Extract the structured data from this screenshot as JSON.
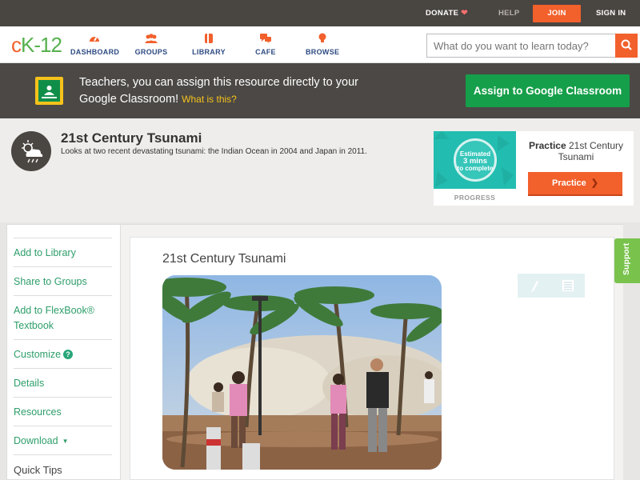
{
  "topbar": {
    "donate": "DONATE",
    "help": "HELP",
    "join": "JOIN",
    "signin": "SIGN IN"
  },
  "nav": {
    "logo_c": "c",
    "logo_k": "K",
    "logo_dash": "-",
    "logo_num": "12",
    "items": [
      {
        "label": "DASHBOARD",
        "icon": "dashboard-icon"
      },
      {
        "label": "GROUPS",
        "icon": "groups-icon"
      },
      {
        "label": "LIBRARY",
        "icon": "library-icon"
      },
      {
        "label": "CAFE",
        "icon": "cafe-icon"
      },
      {
        "label": "BROWSE",
        "icon": "browse-icon"
      }
    ],
    "search_placeholder": "What do you want to learn today?"
  },
  "banner": {
    "text": "Teachers, you can assign this resource directly to your Google Classroom!",
    "link": "What is this?",
    "button": "Assign to Google Classroom"
  },
  "resource": {
    "title": "21st Century Tsunami",
    "description": "Looks at two recent devastating tsunami: the Indian Ocean in 2004 and Japan in 2011."
  },
  "practice": {
    "estimated_line1": "Estimated",
    "estimated_line2": "3 mins",
    "estimated_line3": "to complete",
    "progress_label": "PROGRESS",
    "title_bold": "Practice",
    "title_rest": "21st Century Tsunami",
    "button": "Practice"
  },
  "sidebar": {
    "items": [
      {
        "label": "Add to Library"
      },
      {
        "label": "Share to Groups"
      },
      {
        "label": "Add to FlexBook® Textbook"
      },
      {
        "label": "Customize"
      },
      {
        "label": "Details"
      },
      {
        "label": "Resources"
      },
      {
        "label": "Download"
      },
      {
        "label": "Quick Tips"
      }
    ]
  },
  "content": {
    "title": "21st Century Tsunami"
  },
  "support": "Support",
  "colors": {
    "accent_orange": "#f2602c",
    "brand_green": "#56b14d",
    "link_green": "#2e9e6a",
    "classroom_green": "#169f4a",
    "teal": "#22bdb0"
  }
}
